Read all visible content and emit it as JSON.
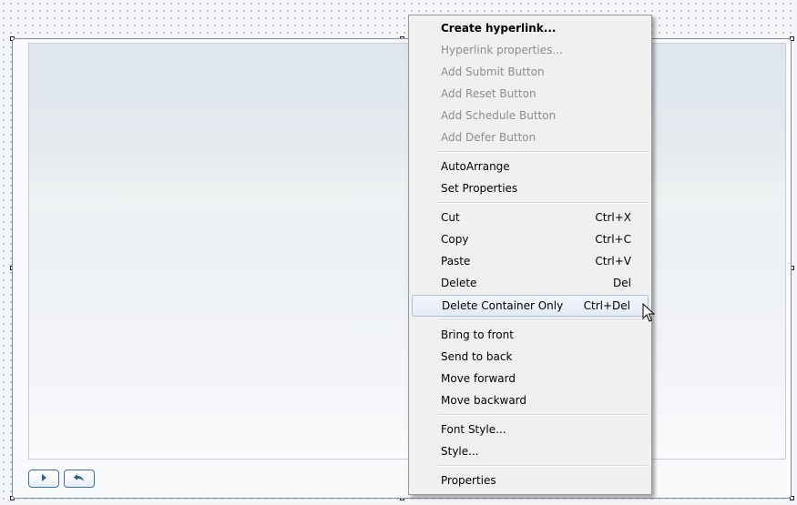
{
  "menu": {
    "groups": [
      [
        {
          "label": "Create hyperlink...",
          "shortcut": "",
          "state": "bold"
        },
        {
          "label": "Hyperlink properties...",
          "shortcut": "",
          "state": "disabled"
        },
        {
          "label": "Add Submit Button",
          "shortcut": "",
          "state": "disabled"
        },
        {
          "label": "Add Reset Button",
          "shortcut": "",
          "state": "disabled"
        },
        {
          "label": "Add Schedule Button",
          "shortcut": "",
          "state": "disabled"
        },
        {
          "label": "Add Defer Button",
          "shortcut": "",
          "state": "disabled"
        }
      ],
      [
        {
          "label": "AutoArrange",
          "shortcut": "",
          "state": "normal"
        },
        {
          "label": "Set Properties",
          "shortcut": "",
          "state": "normal"
        }
      ],
      [
        {
          "label": "Cut",
          "shortcut": "Ctrl+X",
          "state": "normal"
        },
        {
          "label": "Copy",
          "shortcut": "Ctrl+C",
          "state": "normal"
        },
        {
          "label": "Paste",
          "shortcut": "Ctrl+V",
          "state": "normal"
        },
        {
          "label": "Delete",
          "shortcut": "Del",
          "state": "normal"
        },
        {
          "label": "Delete Container Only",
          "shortcut": "Ctrl+Del",
          "state": "highlight"
        }
      ],
      [
        {
          "label": "Bring to front",
          "shortcut": "",
          "state": "normal"
        },
        {
          "label": "Send to back",
          "shortcut": "",
          "state": "normal"
        },
        {
          "label": "Move forward",
          "shortcut": "",
          "state": "normal"
        },
        {
          "label": "Move backward",
          "shortcut": "",
          "state": "normal"
        }
      ],
      [
        {
          "label": "Font Style...",
          "shortcut": "",
          "state": "normal"
        },
        {
          "label": "Style...",
          "shortcut": "",
          "state": "normal"
        }
      ],
      [
        {
          "label": "Properties",
          "shortcut": "",
          "state": "normal"
        }
      ]
    ]
  },
  "buttons": [
    {
      "name": "play-button",
      "icon": "play-icon"
    },
    {
      "name": "undo-button",
      "icon": "undo-arrow-icon"
    }
  ],
  "colors": {
    "accent": "#3d6fa8",
    "menu_bg": "#f0f0f0",
    "highlight_border": "#a8c1e0"
  }
}
